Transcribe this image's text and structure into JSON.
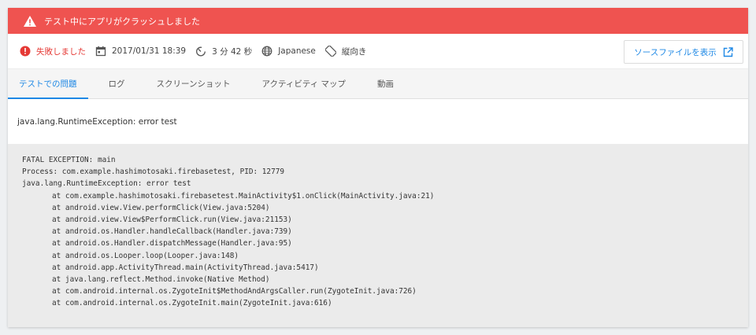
{
  "banner": {
    "message": "テスト中にアプリがクラッシュしました",
    "icon": "warning-icon",
    "color": "#ef5350"
  },
  "meta": {
    "status": "失敗しました",
    "date": "2017/01/31 18:39",
    "duration": "3 分 42 秒",
    "locale": "Japanese",
    "orientation": "縦向き"
  },
  "source_button": {
    "label": "ソースファイルを表示"
  },
  "tabs": [
    {
      "label": "テストでの問題",
      "active": true
    },
    {
      "label": "ログ",
      "active": false
    },
    {
      "label": "スクリーンショット",
      "active": false
    },
    {
      "label": "アクティビティ マップ",
      "active": false
    },
    {
      "label": "動画",
      "active": false
    }
  ],
  "exception": {
    "title": "java.lang.RuntimeException: error test"
  },
  "stack_trace": [
    {
      "text": "FATAL EXCEPTION: main",
      "indent": false
    },
    {
      "text": "Process: com.example.hashimotosaki.firebasetest, PID: 12779",
      "indent": false
    },
    {
      "text": "java.lang.RuntimeException: error test",
      "indent": false
    },
    {
      "text": "at com.example.hashimotosaki.firebasetest.MainActivity$1.onClick(MainActivity.java:21)",
      "indent": true
    },
    {
      "text": "at android.view.View.performClick(View.java:5204)",
      "indent": true
    },
    {
      "text": "at android.view.View$PerformClick.run(View.java:21153)",
      "indent": true
    },
    {
      "text": "at android.os.Handler.handleCallback(Handler.java:739)",
      "indent": true
    },
    {
      "text": "at android.os.Handler.dispatchMessage(Handler.java:95)",
      "indent": true
    },
    {
      "text": "at android.os.Looper.loop(Looper.java:148)",
      "indent": true
    },
    {
      "text": "at android.app.ActivityThread.main(ActivityThread.java:5417)",
      "indent": true
    },
    {
      "text": "at java.lang.reflect.Method.invoke(Native Method)",
      "indent": true
    },
    {
      "text": "at com.android.internal.os.ZygoteInit$MethodAndArgsCaller.run(ZygoteInit.java:726)",
      "indent": true
    },
    {
      "text": "at com.android.internal.os.ZygoteInit.main(ZygoteInit.java:616)",
      "indent": true
    }
  ],
  "colors": {
    "accent": "#1e88e5",
    "error": "#e53935"
  }
}
